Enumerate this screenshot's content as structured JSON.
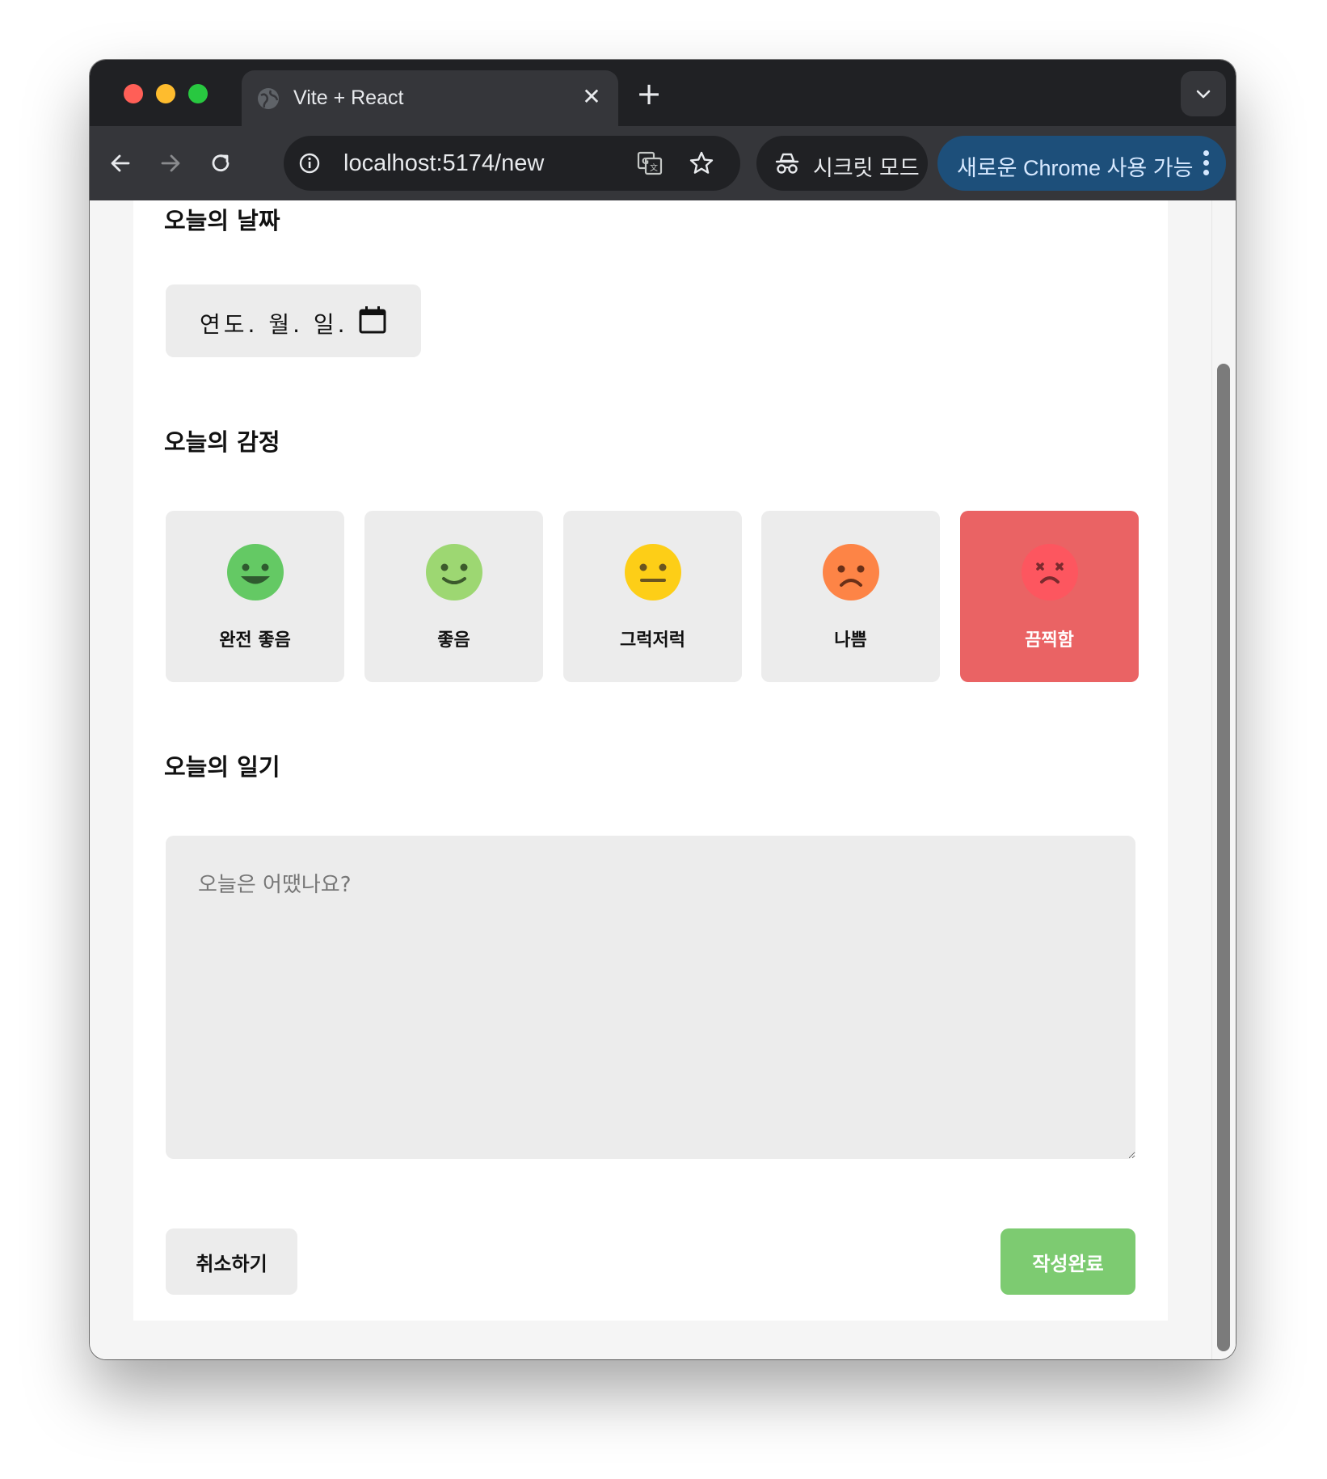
{
  "browser": {
    "tab_title": "Vite + React",
    "url": "localhost:5174/new",
    "incognito_label": "시크릿 모드",
    "update_label": "새로운 Chrome 사용 가능"
  },
  "form": {
    "date_section_title": "오늘의 날짜",
    "date_placeholder": "연도. 월. 일.",
    "emotion_section_title": "오늘의 감정",
    "emotions": [
      {
        "label": "완전 좋음",
        "color": "#64c964",
        "face": "grin",
        "selected": false
      },
      {
        "label": "좋음",
        "color": "#9dd772",
        "face": "smile",
        "selected": false
      },
      {
        "label": "그럭저럭",
        "color": "#fdce17",
        "face": "neutral",
        "selected": false
      },
      {
        "label": "나쁨",
        "color": "#fd8446",
        "face": "frown",
        "selected": false
      },
      {
        "label": "끔찍함",
        "color": "#fd565f",
        "face": "dead",
        "selected": true
      }
    ],
    "diary_section_title": "오늘의 일기",
    "diary_placeholder": "오늘은 어땠나요?",
    "diary_value": "",
    "cancel_label": "취소하기",
    "submit_label": "작성완료"
  },
  "colors": {
    "selected_emotion_bg": "#ea6364",
    "submit_bg": "#7dcb71",
    "input_bg": "#ececec"
  }
}
